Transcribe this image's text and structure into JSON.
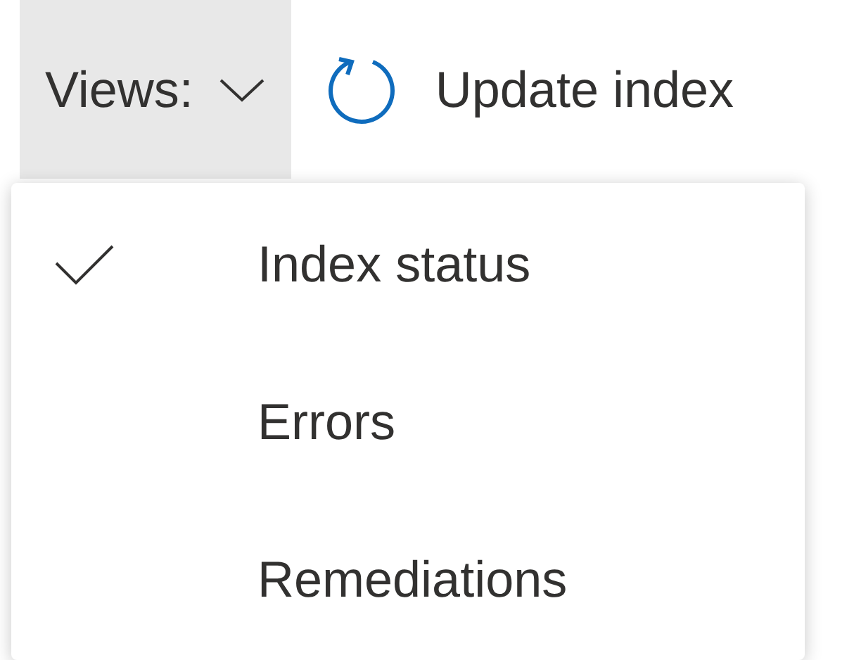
{
  "toolbar": {
    "views_button": {
      "label": "Views:",
      "expanded": true
    },
    "update_button": {
      "label": "Update index"
    }
  },
  "views_menu": {
    "items": [
      {
        "label": "Index status",
        "selected": true
      },
      {
        "label": "Errors",
        "selected": false
      },
      {
        "label": "Remediations",
        "selected": false
      }
    ]
  }
}
